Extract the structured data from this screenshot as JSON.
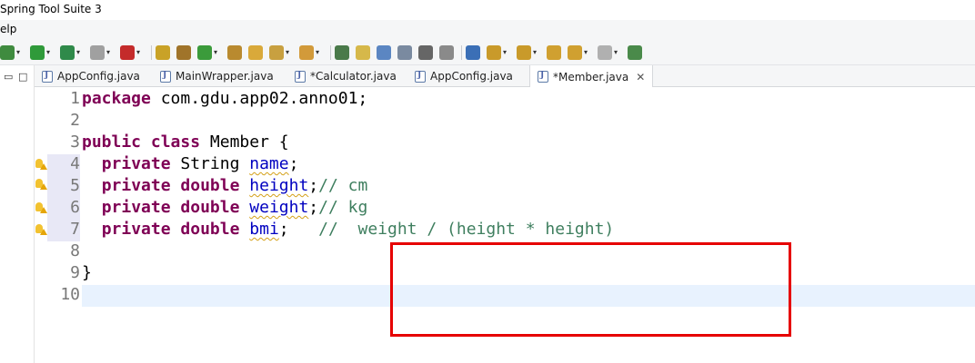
{
  "window": {
    "title": "Spring Tool Suite 3"
  },
  "menu": {
    "items": [
      "elp"
    ]
  },
  "toolbar": {
    "buttons": [
      {
        "icon": "debug-icon",
        "color": "#3f8b3f",
        "dropdown": true
      },
      {
        "icon": "run-icon",
        "color": "#2f9a3a",
        "dropdown": true
      },
      {
        "icon": "run-external-icon",
        "color": "#2f8a4a",
        "dropdown": true
      },
      {
        "icon": "stop-icon",
        "color": "#a0a0a0",
        "dropdown": true
      },
      {
        "icon": "server-icon",
        "color": "#c42b2b",
        "dropdown": true
      },
      {
        "icon": "open-type-icon",
        "color": "#c9a227",
        "dropdown": false
      },
      {
        "icon": "new-package-icon",
        "color": "#a0742a",
        "dropdown": false
      },
      {
        "icon": "new-class-icon",
        "color": "#3b9b3b",
        "dropdown": true
      },
      {
        "icon": "open-task-icon",
        "color": "#b98a2f",
        "dropdown": false
      },
      {
        "icon": "folder-icon",
        "color": "#d9a93a",
        "dropdown": false
      },
      {
        "icon": "search-icon",
        "color": "#c8a040",
        "dropdown": true
      },
      {
        "icon": "open-project-icon",
        "color": "#d29a3a",
        "dropdown": true
      },
      {
        "icon": "pin-icon",
        "color": "#4a7a4a",
        "dropdown": false
      },
      {
        "icon": "edit-icon",
        "color": "#d6b84a",
        "dropdown": false
      },
      {
        "icon": "mark-occurrences-icon",
        "color": "#5b86c2",
        "dropdown": false
      },
      {
        "icon": "block-selection-icon",
        "color": "#7a8aa0",
        "dropdown": false
      },
      {
        "icon": "show-whitespace-icon",
        "color": "#666666",
        "dropdown": false
      },
      {
        "icon": "annotation-icon",
        "color": "#8a8a8a",
        "dropdown": false
      },
      {
        "icon": "globe-icon",
        "color": "#3b6fb6",
        "dropdown": false
      },
      {
        "icon": "next-annotation-icon",
        "color": "#c99a2a",
        "dropdown": true
      },
      {
        "icon": "prev-annotation-icon",
        "color": "#c99a2a",
        "dropdown": true
      },
      {
        "icon": "last-edit-icon",
        "color": "#d0a030",
        "dropdown": false
      },
      {
        "icon": "back-icon",
        "color": "#d0a030",
        "dropdown": true
      },
      {
        "icon": "forward-icon",
        "color": "#b0b0b0",
        "dropdown": true
      },
      {
        "icon": "new-window-icon",
        "color": "#4a8a4a",
        "dropdown": false
      }
    ]
  },
  "left_pane": {
    "buttons": [
      "▭",
      "□"
    ]
  },
  "tabs": [
    {
      "label": "AppConfig.java",
      "active": false
    },
    {
      "label": "MainWrapper.java",
      "active": false
    },
    {
      "label": "*Calculator.java",
      "active": false
    },
    {
      "label": "AppConfig.java",
      "active": false
    },
    {
      "label": "*Member.java",
      "active": true
    }
  ],
  "tab_close": "✕",
  "editor": {
    "line_numbers": [
      "1",
      "2",
      "3",
      "4",
      "5",
      "6",
      "7",
      "8",
      "9",
      "10"
    ],
    "lines": [
      {
        "kw1": "package",
        "rest": " com.gdu.app02.anno01;"
      },
      {},
      {
        "kw1": "public",
        "kw2": "class",
        "rest": " Member {"
      },
      {
        "kw1": "private",
        "type": " String ",
        "field": "name",
        "semi": ";"
      },
      {
        "kw1": "private",
        "kw2": "double",
        "field": "height",
        "semi": ";",
        "comment": "// cm"
      },
      {
        "kw1": "private",
        "kw2": "double",
        "field": "weight",
        "semi": ";",
        "comment": "// kg"
      },
      {
        "kw1": "private",
        "kw2": "double",
        "field": "bmi",
        "semi": ";   ",
        "comment": "//  weight / (height * height)"
      },
      {},
      {
        "rest": "}"
      },
      {}
    ],
    "annotation_colors": {
      "bulb": "#f2c230",
      "warning": "#e5a50a",
      "highlight_box": "#e60000"
    }
  }
}
